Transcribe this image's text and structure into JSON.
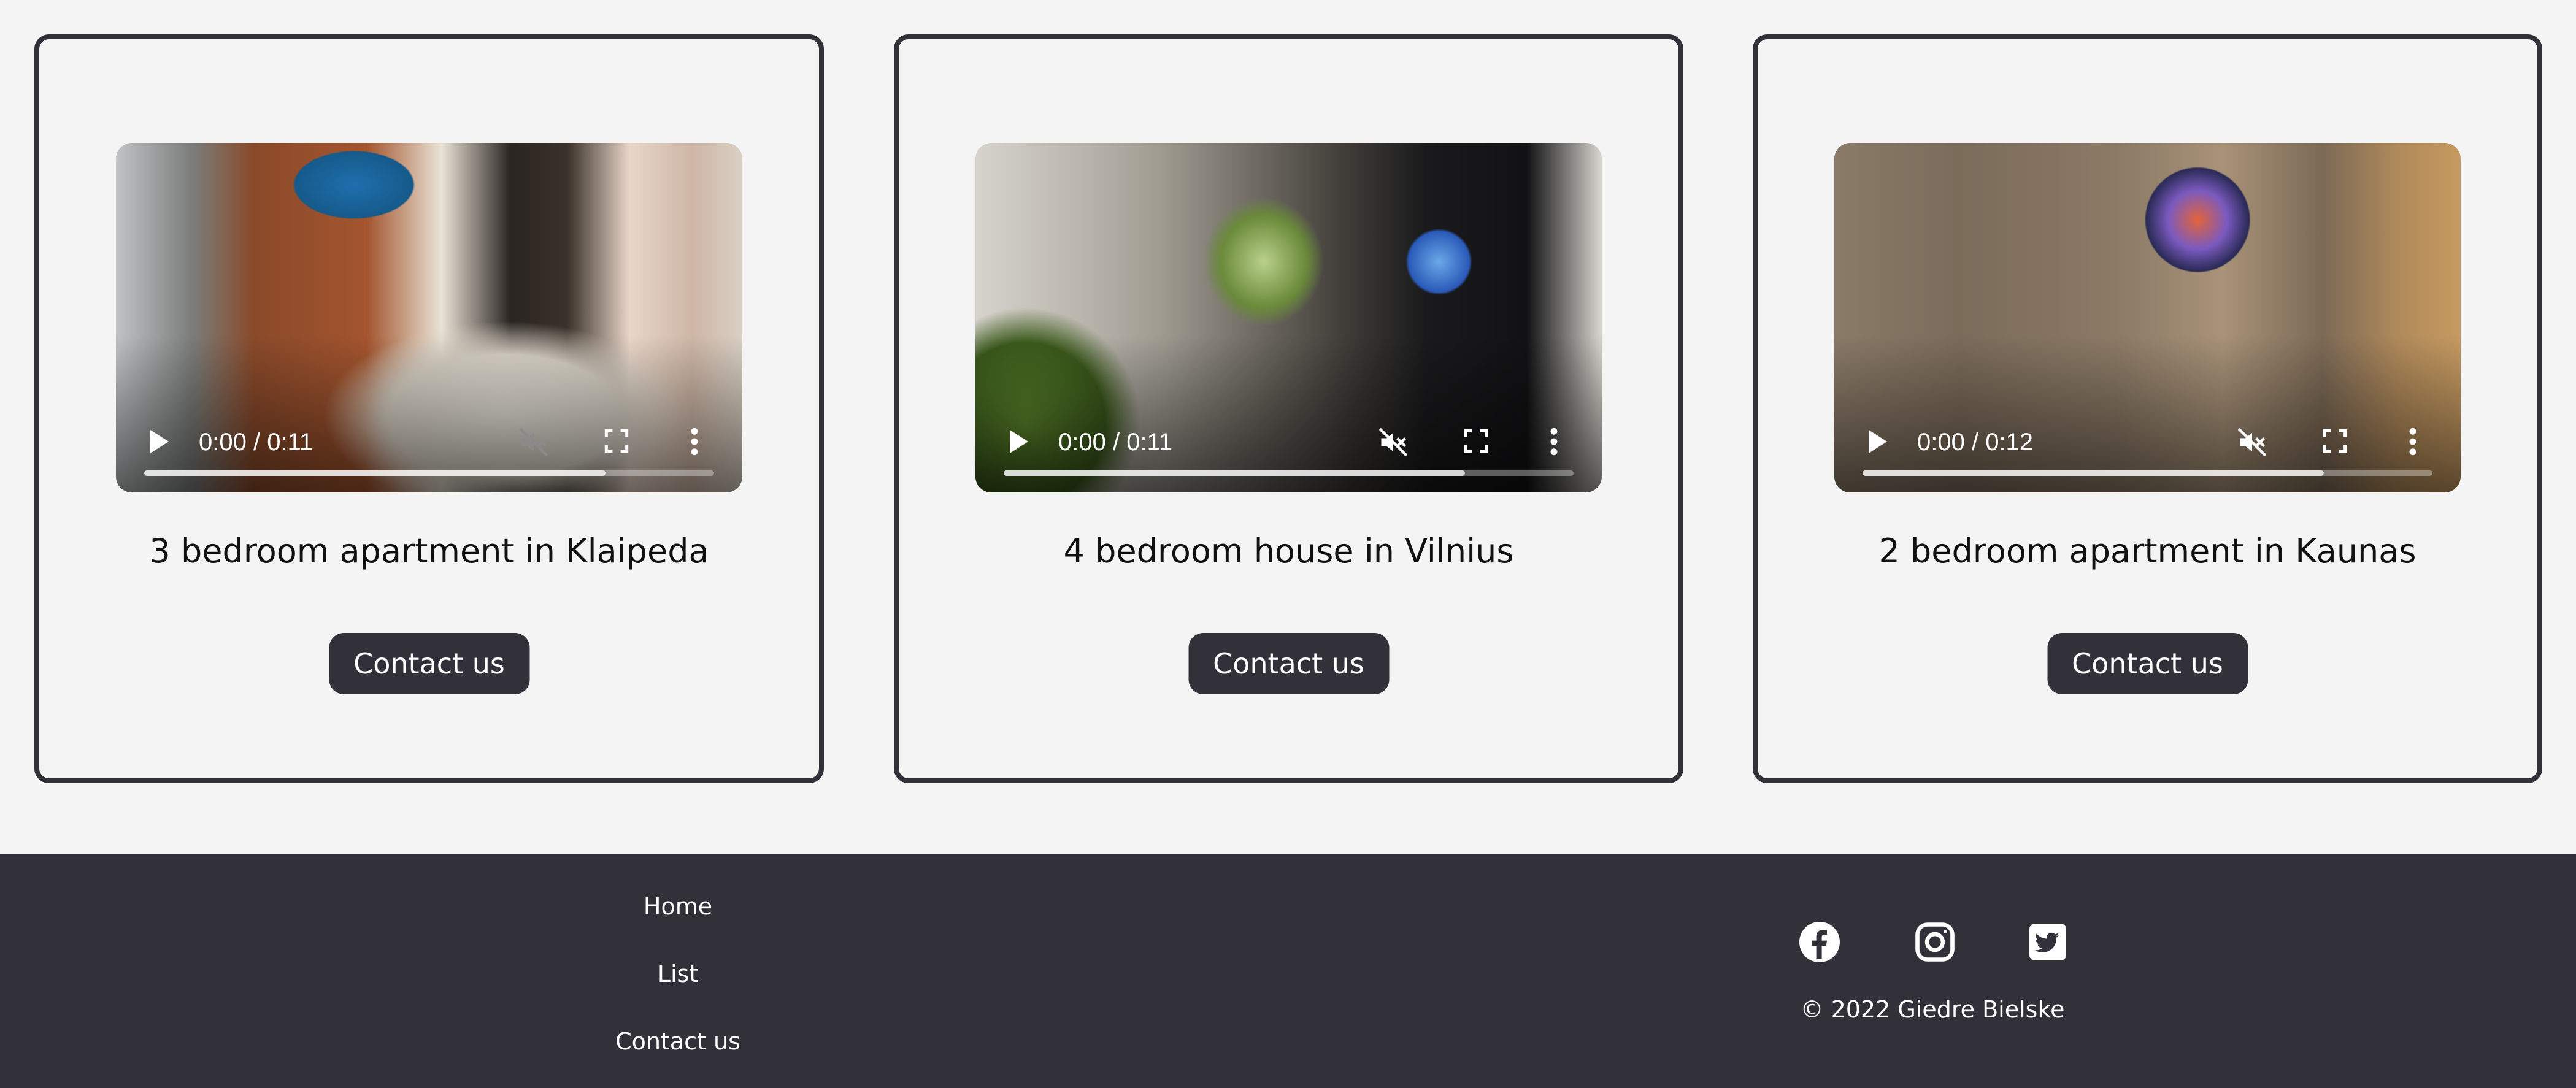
{
  "listings": [
    {
      "title": "3 bedroom apartment in Klaipeda",
      "button_label": "Contact us",
      "video": {
        "time": "0:00 / 0:11",
        "muted": true,
        "buffered_fraction": 0.81
      }
    },
    {
      "title": "4 bedroom house in Vilnius",
      "button_label": "Contact us",
      "video": {
        "time": "0:00 / 0:11",
        "muted": true,
        "buffered_fraction": 0.81
      }
    },
    {
      "title": "2 bedroom apartment in Kaunas",
      "button_label": "Contact us",
      "video": {
        "time": "0:00 / 0:12",
        "muted": true,
        "buffered_fraction": 0.81
      }
    }
  ],
  "footer": {
    "links": [
      "Home",
      "List",
      "Contact us"
    ],
    "social": [
      "facebook-icon",
      "instagram-icon",
      "twitter-icon"
    ],
    "copyright": "© 2022 Giedre Bielske"
  },
  "colors": {
    "page_background": "#f4f4f4",
    "dark": "#32313a",
    "text_on_dark": "#ffffff"
  }
}
